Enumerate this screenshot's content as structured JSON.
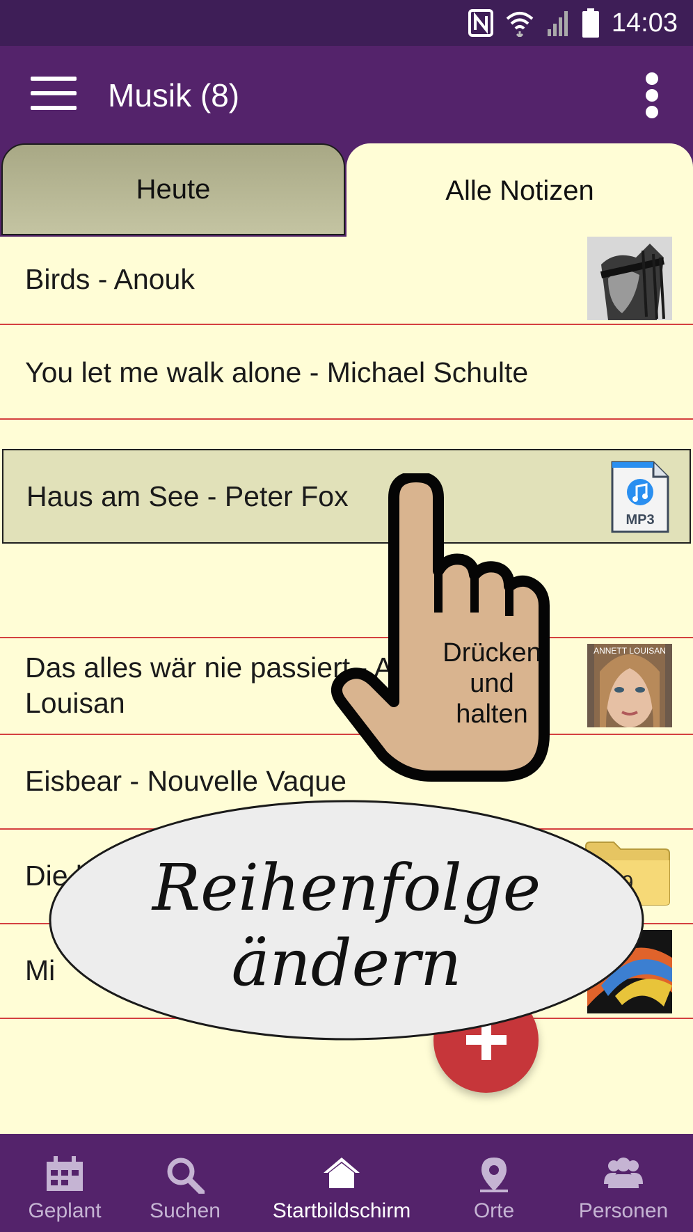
{
  "status_bar": {
    "time": "14:03",
    "icons": [
      "nfc-icon",
      "wifi-icon",
      "signal-icon",
      "battery-icon"
    ]
  },
  "app_bar": {
    "title": "Musik (8)",
    "menu_icon": "hamburger-icon",
    "overflow_icon": "more-vert-icon"
  },
  "tabs": [
    {
      "label": "Heute",
      "selected": false
    },
    {
      "label": "Alle Notizen",
      "selected": true
    }
  ],
  "notes": [
    {
      "title": "Birds - Anouk",
      "thumbnail": "album-cover-anouk"
    },
    {
      "title": "You let me walk alone - Michael Schulte",
      "thumbnail": ""
    },
    {
      "title": "Haus am See - Peter Fox",
      "thumbnail": "mp3-file-icon",
      "thumb_text": "MP3",
      "selected": true
    },
    {
      "title_line1": "Das alles wär nie passiert - A",
      "title_line2": "Louisan",
      "thumbnail": "album-cover-annett-louisan",
      "thumb_text": "ANNETT LOUISAN"
    },
    {
      "title": "Eisbear - Nouvelle Vaque",
      "thumbnail": ""
    },
    {
      "title": "Die be",
      "thumbnail": "folder-icon",
      "folder_count": "9"
    },
    {
      "title": "Mi",
      "thumbnail": "album-cover-colorful"
    }
  ],
  "overlay": {
    "hint_line1": "Drücken",
    "hint_line2": "und",
    "hint_line3": "halten",
    "caption_line1": "Reihenfolge",
    "caption_line2": "ändern"
  },
  "fab": {
    "icon": "plus-icon"
  },
  "bottom_nav": [
    {
      "label": "Geplant",
      "icon": "calendar-icon"
    },
    {
      "label": "Suchen",
      "icon": "search-icon"
    },
    {
      "label": "Startbildschirm",
      "icon": "home-icon",
      "active": true
    },
    {
      "label": "Orte",
      "icon": "location-pin-icon"
    },
    {
      "label": "Personen",
      "icon": "people-icon"
    }
  ],
  "colors": {
    "status_bar": "#3e1e57",
    "app_bar": "#54236b",
    "list_background": "#fffdd6",
    "row_divider": "#d4403f",
    "selected_row": "#e1e1b9",
    "fab": "#c6363a"
  }
}
